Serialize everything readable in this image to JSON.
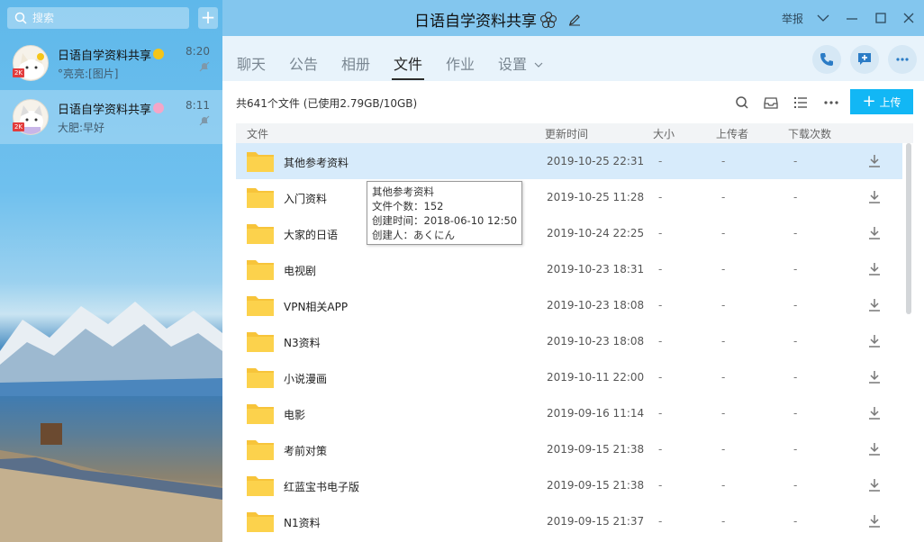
{
  "search": {
    "placeholder": "搜索"
  },
  "chats": [
    {
      "name": "日语自学资料共享",
      "preview": "°亮亮:[图片]",
      "time": "8:20",
      "badge": "2K",
      "deco_color": "#f5c518"
    },
    {
      "name": "日语自学资料共享",
      "preview": "大肥:早好",
      "time": "8:11",
      "badge": "2K",
      "deco_color": "#f4a6c8"
    }
  ],
  "titlebar": {
    "title": "日语自学资料共享",
    "report": "举报"
  },
  "tabs": [
    {
      "label": "聊天"
    },
    {
      "label": "公告"
    },
    {
      "label": "相册"
    },
    {
      "label": "文件"
    },
    {
      "label": "作业"
    },
    {
      "label": "设置"
    }
  ],
  "files": {
    "summary": "共641个文件 (已使用2.79GB/10GB)",
    "upload_label": "上传",
    "columns": {
      "name": "文件",
      "time": "更新时间",
      "size": "大小",
      "uploader": "上传者",
      "downloads": "下载次数"
    },
    "rows": [
      {
        "name": "其他参考资料",
        "time": "2019-10-25 22:31",
        "size": "-",
        "uploader": "-",
        "downloads": "-"
      },
      {
        "name": "入门资料",
        "time": "2019-10-25 11:28",
        "size": "-",
        "uploader": "-",
        "downloads": "-"
      },
      {
        "name": "大家的日语",
        "time": "2019-10-24 22:25",
        "size": "-",
        "uploader": "-",
        "downloads": "-"
      },
      {
        "name": "电视剧",
        "time": "2019-10-23 18:31",
        "size": "-",
        "uploader": "-",
        "downloads": "-"
      },
      {
        "name": "VPN相关APP",
        "time": "2019-10-23 18:08",
        "size": "-",
        "uploader": "-",
        "downloads": "-"
      },
      {
        "name": "N3资料",
        "time": "2019-10-23 18:08",
        "size": "-",
        "uploader": "-",
        "downloads": "-"
      },
      {
        "name": "小说漫画",
        "time": "2019-10-11 22:00",
        "size": "-",
        "uploader": "-",
        "downloads": "-"
      },
      {
        "name": "电影",
        "time": "2019-09-16 11:14",
        "size": "-",
        "uploader": "-",
        "downloads": "-"
      },
      {
        "name": "考前对策",
        "time": "2019-09-15 21:38",
        "size": "-",
        "uploader": "-",
        "downloads": "-"
      },
      {
        "name": "红蓝宝书电子版",
        "time": "2019-09-15 21:38",
        "size": "-",
        "uploader": "-",
        "downloads": "-"
      },
      {
        "name": "N1资料",
        "time": "2019-09-15 21:37",
        "size": "-",
        "uploader": "-",
        "downloads": "-"
      }
    ]
  },
  "tooltip": {
    "line1": "其他参考资料",
    "line2": "文件个数：152",
    "line3": "创建时间：2018-06-10 12:50",
    "line4": "创建人：あくにん"
  },
  "colors": {
    "accent": "#12b7f5",
    "titlebar": "#83c6ee",
    "tabbar": "#e8f3fb",
    "folder": "#fcd24c",
    "selected_row": "#d7ebfb"
  }
}
